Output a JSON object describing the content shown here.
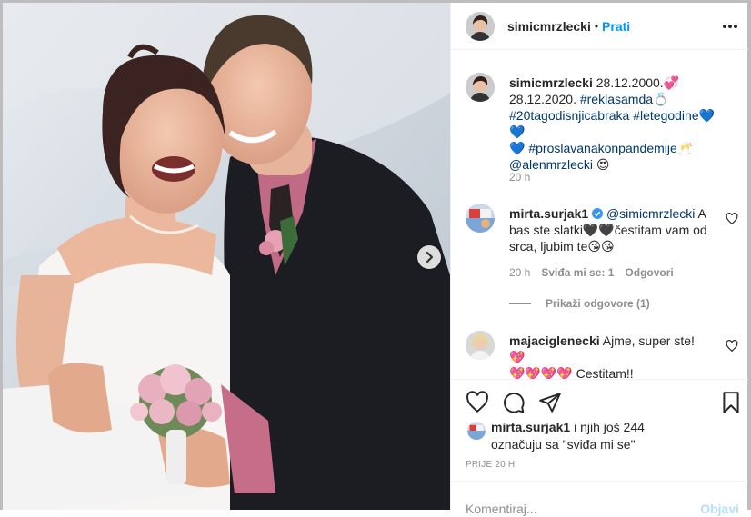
{
  "post": {
    "username": "simicmrzlecki",
    "follow_label": "Prati",
    "more_icon": "more-horizontal-icon",
    "photo_alt": "wedding photo"
  },
  "caption": {
    "username": "simicmrzlecki",
    "text_1": "28.12.2000.💞",
    "text_2": "28.12.2020.",
    "tag_1": "#reklasamda💍",
    "tag_2": "#20tagodisnjicabraka",
    "tag_3": "#letegodine",
    "hearts": "💙💙",
    "heart_3": "💙",
    "tag_4": "#proslavanakonpandemije",
    "emoji_box": "🥂",
    "mention": "@alenmrzlecki",
    "emoji_end": "😍",
    "time": "20 h"
  },
  "comments": [
    {
      "username": "mirta.surjak1",
      "verified": true,
      "mention": "@simicmrzlecki",
      "text_a": "A",
      "text_b": "bas ste slatki🖤🖤čestitam vam od",
      "text_c": "srca, ljubim te😘😘",
      "time": "20 h",
      "likes": "Sviđa mi se: 1",
      "reply": "Odgovori",
      "view_replies": "Prikaži odgovore (1)"
    },
    {
      "username": "majaciglenecki",
      "text_a": "Ajme, super ste! 💖",
      "text_b": "💖💖💖💖 Cestitam!!"
    }
  ],
  "likes": {
    "user": "mirta.surjak1",
    "others": "i njih još 244",
    "line2": "označuju sa \"sviđa mi se\""
  },
  "timestamp": "PRIJE 20 H",
  "add_comment": {
    "placeholder": "Komentiraj...",
    "post_label": "Objavi"
  },
  "colors": {
    "link": "#00376b",
    "follow": "#0095f6",
    "muted": "#8e8e8e",
    "verified": "#3897f0"
  }
}
